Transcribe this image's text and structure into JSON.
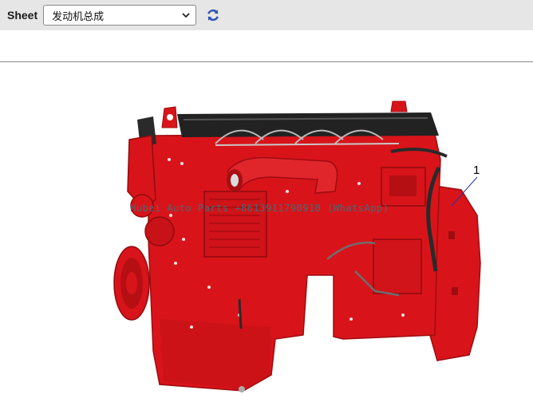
{
  "toolbar": {
    "sheet_label": "Sheet",
    "sheet_select": {
      "selected": "发动机总成"
    },
    "refresh_icon": "refresh-icon"
  },
  "diagram": {
    "watermark": "Hubei Auto Parts +8613911790918 (WhatsApp)",
    "callouts": [
      {
        "label": "1"
      }
    ],
    "colors": {
      "engine_red": "#d8141a",
      "engine_dark_red": "#9e0c10",
      "valve_cover": "#222222"
    }
  }
}
